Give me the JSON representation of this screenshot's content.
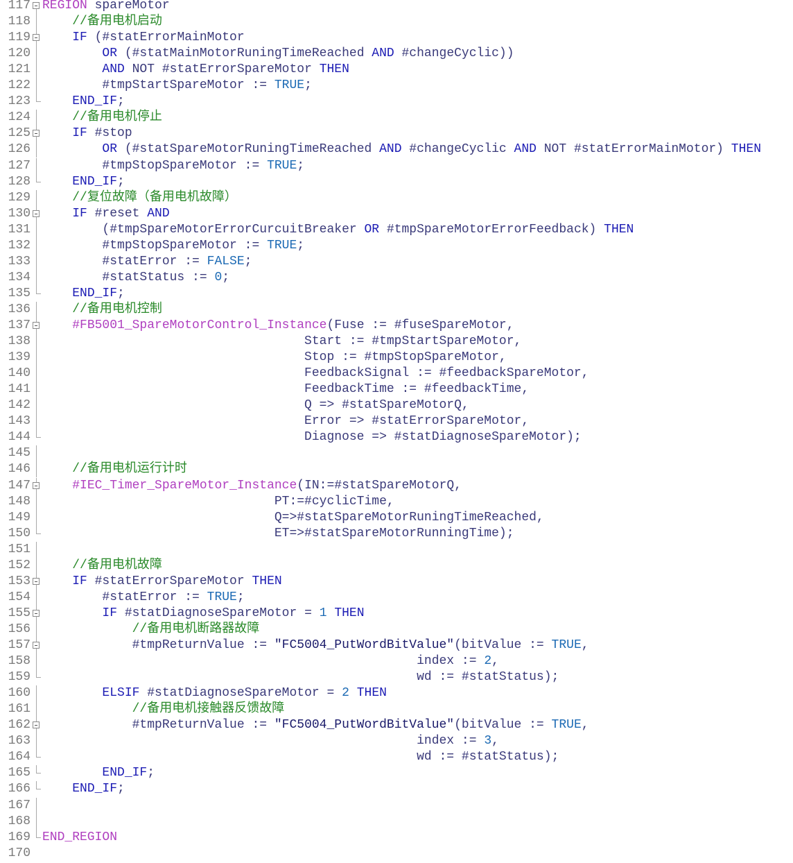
{
  "editor": {
    "lines": [
      {
        "n": "117",
        "fold": "start",
        "tokens": [
          {
            "t": "REGION",
            "c": "region"
          },
          {
            "t": " spareMotor",
            "c": "txt"
          }
        ]
      },
      {
        "n": "118",
        "fold": "line",
        "tokens": [
          {
            "t": "    ",
            "c": "txt"
          },
          {
            "t": "//备用电机启动",
            "c": "cmt"
          }
        ]
      },
      {
        "n": "119",
        "fold": "start",
        "tokens": [
          {
            "t": "    ",
            "c": "txt"
          },
          {
            "t": "IF",
            "c": "kw"
          },
          {
            "t": " (#statErrorMainMotor",
            "c": "txt"
          }
        ]
      },
      {
        "n": "120",
        "fold": "line",
        "tokens": [
          {
            "t": "        ",
            "c": "txt"
          },
          {
            "t": "OR",
            "c": "kw"
          },
          {
            "t": " (#statMainMotorRuningTimeReached ",
            "c": "txt"
          },
          {
            "t": "AND",
            "c": "kw"
          },
          {
            "t": " #changeCyclic))",
            "c": "txt"
          }
        ]
      },
      {
        "n": "121",
        "fold": "line",
        "tokens": [
          {
            "t": "        ",
            "c": "txt"
          },
          {
            "t": "AND",
            "c": "kw"
          },
          {
            "t": " NOT #statErrorSpareMotor ",
            "c": "txt"
          },
          {
            "t": "THEN",
            "c": "kw"
          }
        ]
      },
      {
        "n": "122",
        "fold": "line",
        "tokens": [
          {
            "t": "        #tmpStartSpareMotor := ",
            "c": "txt"
          },
          {
            "t": "TRUE",
            "c": "num"
          },
          {
            "t": ";",
            "c": "txt"
          }
        ]
      },
      {
        "n": "123",
        "fold": "end",
        "tokens": [
          {
            "t": "    ",
            "c": "txt"
          },
          {
            "t": "END_IF",
            "c": "kw"
          },
          {
            "t": ";",
            "c": "txt"
          }
        ]
      },
      {
        "n": "124",
        "fold": "line",
        "tokens": [
          {
            "t": "    ",
            "c": "txt"
          },
          {
            "t": "//备用电机停止",
            "c": "cmt"
          }
        ]
      },
      {
        "n": "125",
        "fold": "start",
        "tokens": [
          {
            "t": "    ",
            "c": "txt"
          },
          {
            "t": "IF",
            "c": "kw"
          },
          {
            "t": " #stop",
            "c": "txt"
          }
        ]
      },
      {
        "n": "126",
        "fold": "line",
        "tokens": [
          {
            "t": "        ",
            "c": "txt"
          },
          {
            "t": "OR",
            "c": "kw"
          },
          {
            "t": " (#statSpareMotorRuningTimeReached ",
            "c": "txt"
          },
          {
            "t": "AND",
            "c": "kw"
          },
          {
            "t": " #changeCyclic ",
            "c": "txt"
          },
          {
            "t": "AND",
            "c": "kw"
          },
          {
            "t": " NOT #statErrorMainMotor) ",
            "c": "txt"
          },
          {
            "t": "THEN",
            "c": "kw"
          }
        ]
      },
      {
        "n": "127",
        "fold": "line",
        "tokens": [
          {
            "t": "        #tmpStopSpareMotor := ",
            "c": "txt"
          },
          {
            "t": "TRUE",
            "c": "num"
          },
          {
            "t": ";",
            "c": "txt"
          }
        ]
      },
      {
        "n": "128",
        "fold": "end",
        "tokens": [
          {
            "t": "    ",
            "c": "txt"
          },
          {
            "t": "END_IF",
            "c": "kw"
          },
          {
            "t": ";",
            "c": "txt"
          }
        ]
      },
      {
        "n": "129",
        "fold": "line",
        "tokens": [
          {
            "t": "    ",
            "c": "txt"
          },
          {
            "t": "//复位故障（备用电机故障）",
            "c": "cmt"
          }
        ]
      },
      {
        "n": "130",
        "fold": "start",
        "tokens": [
          {
            "t": "    ",
            "c": "txt"
          },
          {
            "t": "IF",
            "c": "kw"
          },
          {
            "t": " #reset ",
            "c": "txt"
          },
          {
            "t": "AND",
            "c": "kw"
          }
        ]
      },
      {
        "n": "131",
        "fold": "line",
        "tokens": [
          {
            "t": "        (#tmpSpareMotorErrorCurcuitBreaker ",
            "c": "txt"
          },
          {
            "t": "OR",
            "c": "kw"
          },
          {
            "t": " #tmpSpareMotorErrorFeedback) ",
            "c": "txt"
          },
          {
            "t": "THEN",
            "c": "kw"
          }
        ]
      },
      {
        "n": "132",
        "fold": "line",
        "tokens": [
          {
            "t": "        #tmpStopSpareMotor := ",
            "c": "txt"
          },
          {
            "t": "TRUE",
            "c": "num"
          },
          {
            "t": ";",
            "c": "txt"
          }
        ]
      },
      {
        "n": "133",
        "fold": "line",
        "tokens": [
          {
            "t": "        #statError := ",
            "c": "txt"
          },
          {
            "t": "FALSE",
            "c": "num"
          },
          {
            "t": ";",
            "c": "txt"
          }
        ]
      },
      {
        "n": "134",
        "fold": "line",
        "tokens": [
          {
            "t": "        #statStatus := ",
            "c": "txt"
          },
          {
            "t": "0",
            "c": "num"
          },
          {
            "t": ";",
            "c": "txt"
          }
        ]
      },
      {
        "n": "135",
        "fold": "end",
        "tokens": [
          {
            "t": "    ",
            "c": "txt"
          },
          {
            "t": "END_IF",
            "c": "kw"
          },
          {
            "t": ";",
            "c": "txt"
          }
        ]
      },
      {
        "n": "136",
        "fold": "line",
        "tokens": [
          {
            "t": "    ",
            "c": "txt"
          },
          {
            "t": "//备用电机控制",
            "c": "cmt"
          }
        ]
      },
      {
        "n": "137",
        "fold": "start",
        "tokens": [
          {
            "t": "    ",
            "c": "txt"
          },
          {
            "t": "#FB5001_SpareMotorControl_Instance",
            "c": "region"
          },
          {
            "t": "(Fuse := #fuseSpareMotor,",
            "c": "txt"
          }
        ]
      },
      {
        "n": "138",
        "fold": "line",
        "tokens": [
          {
            "t": "                                   Start := #tmpStartSpareMotor,",
            "c": "txt"
          }
        ]
      },
      {
        "n": "139",
        "fold": "line",
        "tokens": [
          {
            "t": "                                   Stop := #tmpStopSpareMotor,",
            "c": "txt"
          }
        ]
      },
      {
        "n": "140",
        "fold": "line",
        "tokens": [
          {
            "t": "                                   FeedbackSignal := #feedbackSpareMotor,",
            "c": "txt"
          }
        ]
      },
      {
        "n": "141",
        "fold": "line",
        "tokens": [
          {
            "t": "                                   FeedbackTime := #feedbackTime,",
            "c": "txt"
          }
        ]
      },
      {
        "n": "142",
        "fold": "line",
        "tokens": [
          {
            "t": "                                   Q => #statSpareMotorQ,",
            "c": "txt"
          }
        ]
      },
      {
        "n": "143",
        "fold": "line",
        "tokens": [
          {
            "t": "                                   Error => #statErrorSpareMotor,",
            "c": "txt"
          }
        ]
      },
      {
        "n": "144",
        "fold": "end",
        "tokens": [
          {
            "t": "                                   Diagnose => #statDiagnoseSpareMotor);",
            "c": "txt"
          }
        ]
      },
      {
        "n": "145",
        "fold": "line",
        "tokens": []
      },
      {
        "n": "146",
        "fold": "line",
        "tokens": [
          {
            "t": "    ",
            "c": "txt"
          },
          {
            "t": "//备用电机运行计时",
            "c": "cmt"
          }
        ]
      },
      {
        "n": "147",
        "fold": "start",
        "tokens": [
          {
            "t": "    ",
            "c": "txt"
          },
          {
            "t": "#IEC_Timer_SpareMotor_Instance",
            "c": "region"
          },
          {
            "t": "(IN:=#statSpareMotorQ,",
            "c": "txt"
          }
        ]
      },
      {
        "n": "148",
        "fold": "line",
        "tokens": [
          {
            "t": "                               PT:=#cyclicTime,",
            "c": "txt"
          }
        ]
      },
      {
        "n": "149",
        "fold": "line",
        "tokens": [
          {
            "t": "                               Q=>#statSpareMotorRuningTimeReached,",
            "c": "txt"
          }
        ]
      },
      {
        "n": "150",
        "fold": "end",
        "tokens": [
          {
            "t": "                               ET=>#statSpareMotorRunningTime);",
            "c": "txt"
          }
        ]
      },
      {
        "n": "151",
        "fold": "line",
        "tokens": []
      },
      {
        "n": "152",
        "fold": "line",
        "tokens": [
          {
            "t": "    ",
            "c": "txt"
          },
          {
            "t": "//备用电机故障",
            "c": "cmt"
          }
        ]
      },
      {
        "n": "153",
        "fold": "start",
        "tokens": [
          {
            "t": "    ",
            "c": "txt"
          },
          {
            "t": "IF",
            "c": "kw"
          },
          {
            "t": " #statErrorSpareMotor ",
            "c": "txt"
          },
          {
            "t": "THEN",
            "c": "kw"
          }
        ]
      },
      {
        "n": "154",
        "fold": "line",
        "tokens": [
          {
            "t": "        #statError := ",
            "c": "txt"
          },
          {
            "t": "TRUE",
            "c": "num"
          },
          {
            "t": ";",
            "c": "txt"
          }
        ]
      },
      {
        "n": "155",
        "fold": "start",
        "tokens": [
          {
            "t": "        ",
            "c": "txt"
          },
          {
            "t": "IF",
            "c": "kw"
          },
          {
            "t": " #statDiagnoseSpareMotor = ",
            "c": "txt"
          },
          {
            "t": "1",
            "c": "num"
          },
          {
            "t": " ",
            "c": "txt"
          },
          {
            "t": "THEN",
            "c": "kw"
          }
        ]
      },
      {
        "n": "156",
        "fold": "line",
        "tokens": [
          {
            "t": "            ",
            "c": "txt"
          },
          {
            "t": "//备用电机断路器故障",
            "c": "cmt"
          }
        ]
      },
      {
        "n": "157",
        "fold": "start",
        "tokens": [
          {
            "t": "            #tmpReturnValue := ",
            "c": "txt"
          },
          {
            "t": "\"FC5004_PutWordBitValue\"",
            "c": "str"
          },
          {
            "t": "(bitValue := ",
            "c": "txt"
          },
          {
            "t": "TRUE",
            "c": "num"
          },
          {
            "t": ",",
            "c": "txt"
          }
        ]
      },
      {
        "n": "158",
        "fold": "line",
        "tokens": [
          {
            "t": "                                                  index := ",
            "c": "txt"
          },
          {
            "t": "2",
            "c": "num"
          },
          {
            "t": ",",
            "c": "txt"
          }
        ]
      },
      {
        "n": "159",
        "fold": "end",
        "tokens": [
          {
            "t": "                                                  wd := #statStatus);",
            "c": "txt"
          }
        ]
      },
      {
        "n": "160",
        "fold": "line",
        "tokens": [
          {
            "t": "        ",
            "c": "txt"
          },
          {
            "t": "ELSIF",
            "c": "kw"
          },
          {
            "t": " #statDiagnoseSpareMotor = ",
            "c": "txt"
          },
          {
            "t": "2",
            "c": "num"
          },
          {
            "t": " ",
            "c": "txt"
          },
          {
            "t": "THEN",
            "c": "kw"
          }
        ]
      },
      {
        "n": "161",
        "fold": "line",
        "tokens": [
          {
            "t": "            ",
            "c": "txt"
          },
          {
            "t": "//备用电机接触器反馈故障",
            "c": "cmt"
          }
        ]
      },
      {
        "n": "162",
        "fold": "start",
        "tokens": [
          {
            "t": "            #tmpReturnValue := ",
            "c": "txt"
          },
          {
            "t": "\"FC5004_PutWordBitValue\"",
            "c": "str"
          },
          {
            "t": "(bitValue := ",
            "c": "txt"
          },
          {
            "t": "TRUE",
            "c": "num"
          },
          {
            "t": ",",
            "c": "txt"
          }
        ]
      },
      {
        "n": "163",
        "fold": "line",
        "tokens": [
          {
            "t": "                                                  index := ",
            "c": "txt"
          },
          {
            "t": "3",
            "c": "num"
          },
          {
            "t": ",",
            "c": "txt"
          }
        ]
      },
      {
        "n": "164",
        "fold": "end",
        "tokens": [
          {
            "t": "                                                  wd := #statStatus);",
            "c": "txt"
          }
        ]
      },
      {
        "n": "165",
        "fold": "end",
        "tokens": [
          {
            "t": "        ",
            "c": "txt"
          },
          {
            "t": "END_IF",
            "c": "kw"
          },
          {
            "t": ";",
            "c": "txt"
          }
        ]
      },
      {
        "n": "166",
        "fold": "end",
        "tokens": [
          {
            "t": "    ",
            "c": "txt"
          },
          {
            "t": "END_IF",
            "c": "kw"
          },
          {
            "t": ";",
            "c": "txt"
          }
        ]
      },
      {
        "n": "167",
        "fold": "line",
        "tokens": []
      },
      {
        "n": "168",
        "fold": "line",
        "tokens": []
      },
      {
        "n": "169",
        "fold": "end",
        "tokens": [
          {
            "t": "END_REGION",
            "c": "region"
          }
        ]
      },
      {
        "n": "170",
        "fold": "none",
        "tokens": []
      }
    ]
  }
}
